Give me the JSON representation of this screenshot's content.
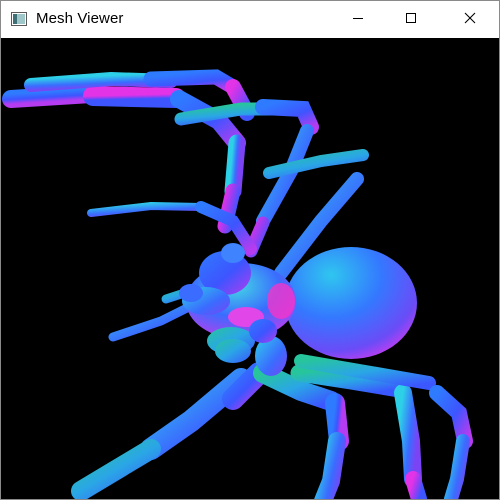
{
  "window": {
    "title": "Mesh Viewer",
    "icons": {
      "app": "app-window-icon",
      "minimize": "minimize-icon",
      "maximize": "maximize-icon",
      "close": "close-icon"
    }
  },
  "viewport": {
    "background": "#000000",
    "model": "spider-mesh",
    "shading": "normal-map",
    "colors": {
      "blue": "#3d55ff",
      "cyan": "#2ed0e8",
      "teal": "#27c59c",
      "magenta": "#d52fe6",
      "violet": "#9b3df2",
      "pink": "#ff32c8"
    }
  }
}
